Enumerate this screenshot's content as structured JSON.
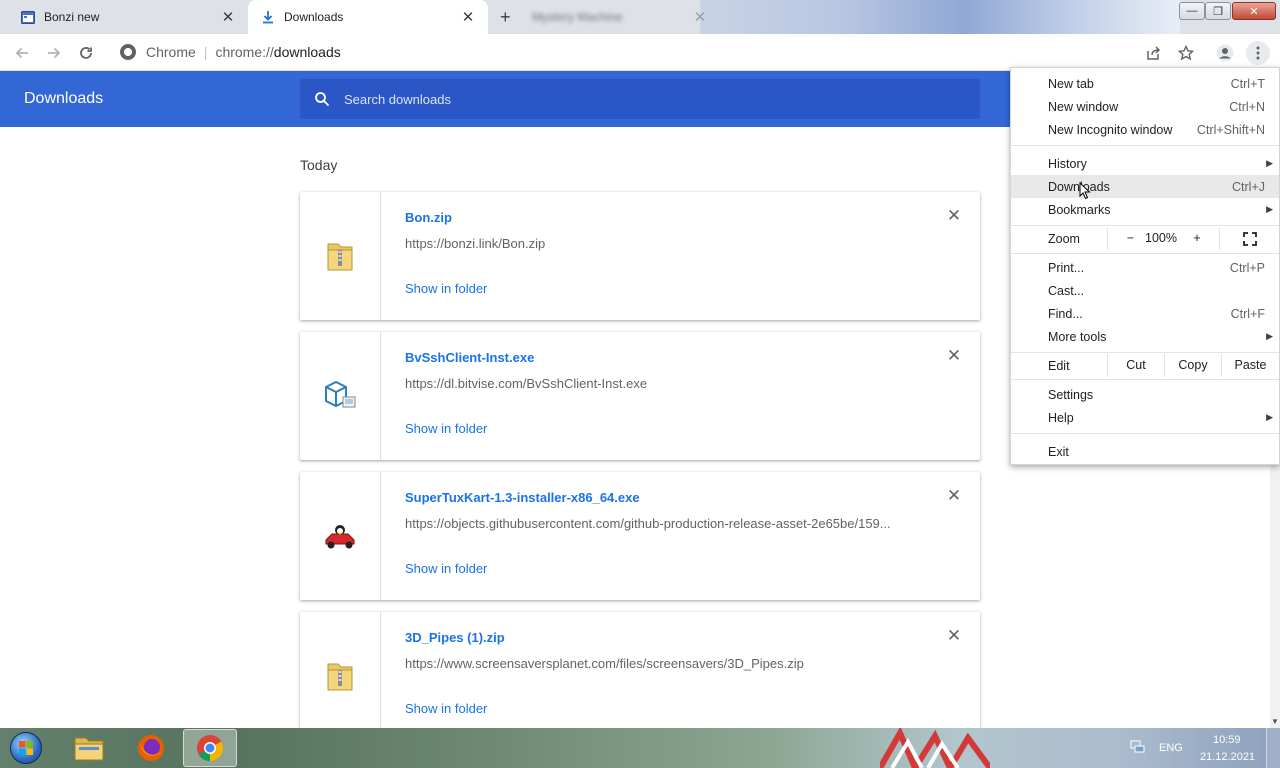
{
  "tabs": [
    {
      "title": "Bonzi new",
      "icon": "calendar-icon"
    },
    {
      "title": "Downloads",
      "icon": "download-icon"
    },
    {
      "title": "Mystery Machine",
      "icon": "globe-icon"
    }
  ],
  "window_controls": {
    "minimize": "—",
    "maximize": "❐",
    "close": "✕"
  },
  "toolbar": {
    "chip_label": "Chrome",
    "url_scheme": "chrome://",
    "url_host": "downloads"
  },
  "page": {
    "title": "Downloads",
    "search_placeholder": "Search downloads",
    "day_label": "Today"
  },
  "downloads": [
    {
      "name": "Bon.zip",
      "url": "https://bonzi.link/Bon.zip",
      "action": "Show in folder",
      "icon": "zip-folder-icon"
    },
    {
      "name": "BvSshClient-Inst.exe",
      "url": "https://dl.bitvise.com/BvSshClient-Inst.exe",
      "action": "Show in folder",
      "icon": "installer-icon"
    },
    {
      "name": "SuperTuxKart-1.3-installer-x86_64.exe",
      "url": "https://objects.githubusercontent.com/github-production-release-asset-2e65be/159...",
      "action": "Show in folder",
      "icon": "kart-icon"
    },
    {
      "name": "3D_Pipes (1).zip",
      "url": "https://www.screensaversplanet.com/files/screensavers/3D_Pipes.zip",
      "action": "Show in folder",
      "icon": "zip-folder-icon"
    }
  ],
  "menu": {
    "new_tab": {
      "label": "New tab",
      "shortcut": "Ctrl+T"
    },
    "new_window": {
      "label": "New window",
      "shortcut": "Ctrl+N"
    },
    "new_incognito": {
      "label": "New Incognito window",
      "shortcut": "Ctrl+Shift+N"
    },
    "history": {
      "label": "History"
    },
    "downloads": {
      "label": "Downloads",
      "shortcut": "Ctrl+J"
    },
    "bookmarks": {
      "label": "Bookmarks"
    },
    "zoom": {
      "label": "Zoom",
      "minus": "−",
      "value": "100%",
      "plus": "+"
    },
    "print": {
      "label": "Print...",
      "shortcut": "Ctrl+P"
    },
    "cast": {
      "label": "Cast..."
    },
    "find": {
      "label": "Find...",
      "shortcut": "Ctrl+F"
    },
    "more_tools": {
      "label": "More tools"
    },
    "edit": {
      "label": "Edit",
      "cut": "Cut",
      "copy": "Copy",
      "paste": "Paste"
    },
    "settings": {
      "label": "Settings"
    },
    "help": {
      "label": "Help"
    },
    "exit": {
      "label": "Exit"
    }
  },
  "taskbar": {
    "language": "ENG",
    "time": "10:59",
    "date": "21.12.2021"
  },
  "colors": {
    "header_blue": "#3367d6",
    "search_blue": "#2a56c6",
    "link_blue": "#1a73e8"
  }
}
